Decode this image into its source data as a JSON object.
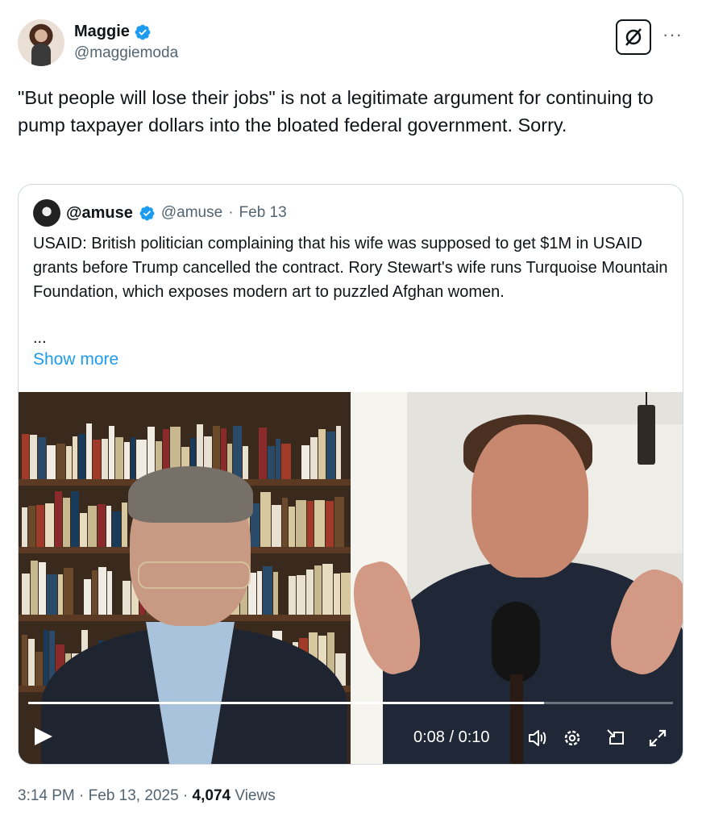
{
  "author": {
    "name": "Maggie",
    "handle": "@maggiemoda",
    "verified": true
  },
  "tweet": {
    "text": "\"But people will lose their jobs\" is not a legitimate argument for continuing to pump taxpayer dollars into the bloated federal government. Sorry."
  },
  "header_actions": {
    "grok_icon": "grok-icon",
    "more_label": "···"
  },
  "quote": {
    "name": "@amuse",
    "handle": "@amuse",
    "separator": "·",
    "date": "Feb 13",
    "text": "USAID: British politician complaining that his wife was supposed to get $1M in USAID grants before Trump cancelled the contract. Rory Stewart's wife runs Turquoise Mountain Foundation, which exposes modern art to puzzled Afghan women.",
    "ellipsis": "...",
    "show_more": "Show more"
  },
  "video": {
    "time_display": "0:08 / 0:10",
    "progress": 0.8,
    "icons": [
      "play-icon",
      "volume-icon",
      "settings-icon",
      "dock-icon",
      "fullscreen-icon"
    ]
  },
  "meta": {
    "time": "3:14 PM",
    "sep1": "·",
    "date": "Feb 13, 2025",
    "sep2": "·",
    "views_count": "4,074",
    "views_label": "Views"
  },
  "colors": {
    "verified": "#1d9bf0",
    "link": "#1d9bf0",
    "secondary_text": "#536471",
    "border": "#cfd9de"
  }
}
